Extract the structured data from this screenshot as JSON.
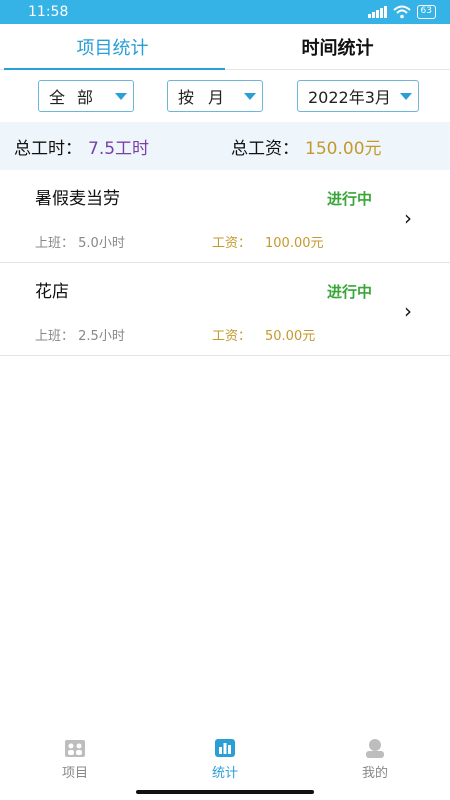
{
  "status_bar": {
    "time": "11:58",
    "battery": "63"
  },
  "tabs": [
    {
      "label": "项目统计",
      "active": true
    },
    {
      "label": "时间统计",
      "active": false
    }
  ],
  "filters": {
    "category": "全部",
    "period": "按月",
    "date": "2022年3月"
  },
  "summary": {
    "hours_label": "总工时：",
    "hours_value": "7.5工时",
    "wage_label": "总工资：",
    "wage_value": "150.00元"
  },
  "projects": [
    {
      "name": "暑假麦当劳",
      "status": "进行中",
      "work_label": "上班：",
      "work_value": "5.0小时",
      "pay_label": "工资：",
      "pay_value": "100.00元"
    },
    {
      "name": "花店",
      "status": "进行中",
      "work_label": "上班：",
      "work_value": "2.5小时",
      "pay_label": "工资：",
      "pay_value": "50.00元"
    }
  ],
  "nav": [
    {
      "label": "项目",
      "icon": "project-icon",
      "active": false
    },
    {
      "label": "统计",
      "icon": "chart-icon",
      "active": true
    },
    {
      "label": "我的",
      "icon": "user-icon",
      "active": false
    }
  ],
  "colors": {
    "accent": "#2a9fd6",
    "status_green": "#3aa63a",
    "wage_gold": "#c49a2e",
    "hours_purple": "#7a3fa8"
  }
}
